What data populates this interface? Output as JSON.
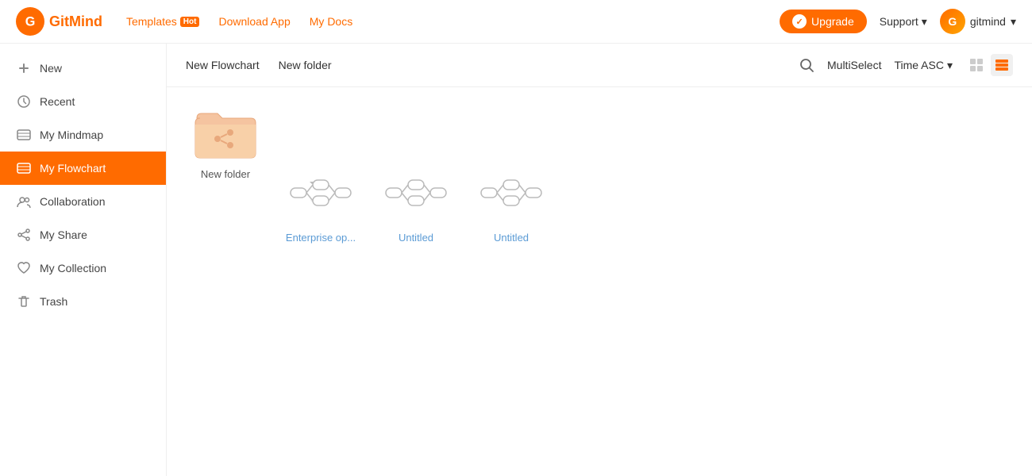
{
  "header": {
    "logo_text": "GitMind",
    "nav": [
      {
        "label": "Templates",
        "badge": "Hot"
      },
      {
        "label": "Download App"
      },
      {
        "label": "My Docs"
      }
    ],
    "upgrade_label": "Upgrade",
    "support_label": "Support",
    "user_label": "gitmind"
  },
  "sidebar": {
    "items": [
      {
        "id": "new",
        "label": "New",
        "icon": "➕"
      },
      {
        "id": "recent",
        "label": "Recent",
        "icon": "🕐"
      },
      {
        "id": "my-mindmap",
        "label": "My Mindmap",
        "icon": "📄"
      },
      {
        "id": "my-flowchart",
        "label": "My Flowchart",
        "icon": "📋",
        "active": true
      },
      {
        "id": "collaboration",
        "label": "Collaboration",
        "icon": "👥"
      },
      {
        "id": "my-share",
        "label": "My Share",
        "icon": "🔗"
      },
      {
        "id": "my-collection",
        "label": "My Collection",
        "icon": "❤"
      },
      {
        "id": "trash",
        "label": "Trash",
        "icon": "🗑"
      }
    ]
  },
  "toolbar": {
    "new_flowchart": "New Flowchart",
    "new_folder": "New folder",
    "multiselect": "MultiSelect",
    "sort": "Time ASC"
  },
  "files": [
    {
      "id": "folder-1",
      "name": "New folder",
      "type": "folder"
    },
    {
      "id": "flowchart-1",
      "name": "Enterprise op...",
      "type": "flowchart"
    },
    {
      "id": "flowchart-2",
      "name": "Untitled",
      "type": "flowchart"
    },
    {
      "id": "flowchart-3",
      "name": "Untitled",
      "type": "flowchart"
    }
  ]
}
